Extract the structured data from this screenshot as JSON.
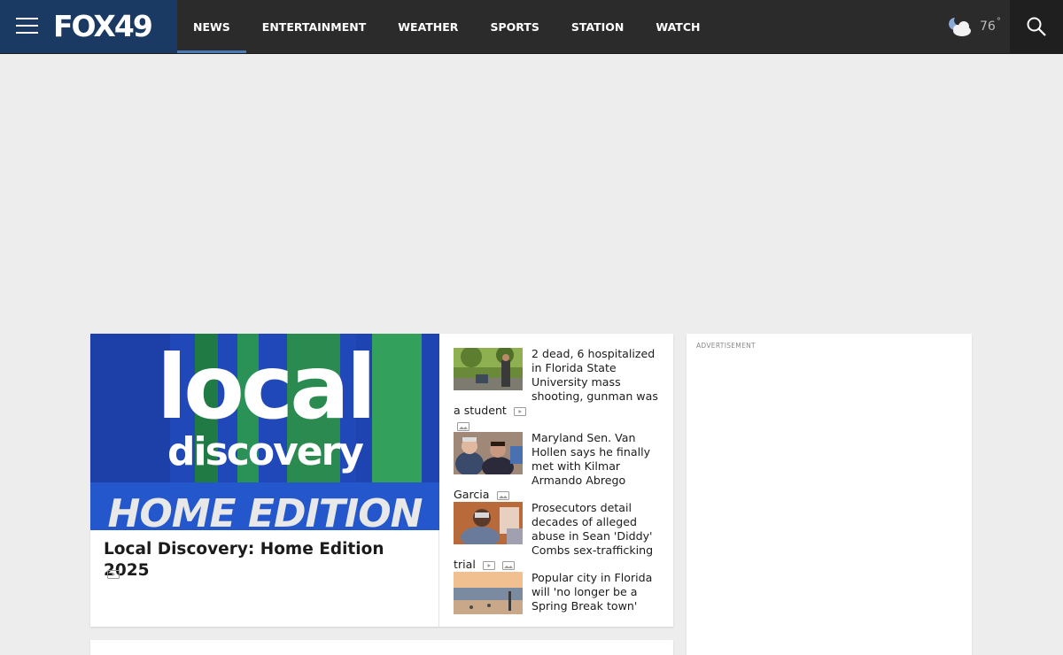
{
  "header": {
    "logo": "FOX49",
    "nav": [
      {
        "label": "NEWS",
        "active": true
      },
      {
        "label": "ENTERTAINMENT"
      },
      {
        "label": "WEATHER"
      },
      {
        "label": "SPORTS"
      },
      {
        "label": "STATION"
      },
      {
        "label": "WATCH"
      }
    ],
    "weather": {
      "temp": "76",
      "unit": "°",
      "icon": "partly-cloudy-night-icon"
    },
    "search_icon": "search-icon"
  },
  "hero": {
    "image_text": {
      "line1": "local",
      "line2": "discovery",
      "line3": "HOME EDITION"
    },
    "title": "Local Discovery: Home Edition 2025",
    "media": "video-icon"
  },
  "stories": [
    {
      "title": "2 dead, 6 hospitalized in Florida State University mass shooting, gunman was a student",
      "media": [
        "video-icon",
        "gallery-icon"
      ]
    },
    {
      "title": "Maryland Sen. Van Hollen says he finally met with Kilmar Armando Abrego Garcia",
      "media": [
        "gallery-icon"
      ]
    },
    {
      "title": "Prosecutors detail decades of alleged abuse in Sean 'Diddy' Combs sex-trafficking trial",
      "media": [
        "video-icon",
        "gallery-icon"
      ]
    },
    {
      "title": "Popular city in Florida will 'no longer be a Spring Break town'",
      "media": []
    }
  ],
  "ad": {
    "label": "ADVERTISEMENT"
  },
  "colors": {
    "header_bg": "#2b2b2b",
    "brand_bg": "#1a3a64",
    "nav_active": "#4a7bb7",
    "page_bg": "#ededed"
  }
}
